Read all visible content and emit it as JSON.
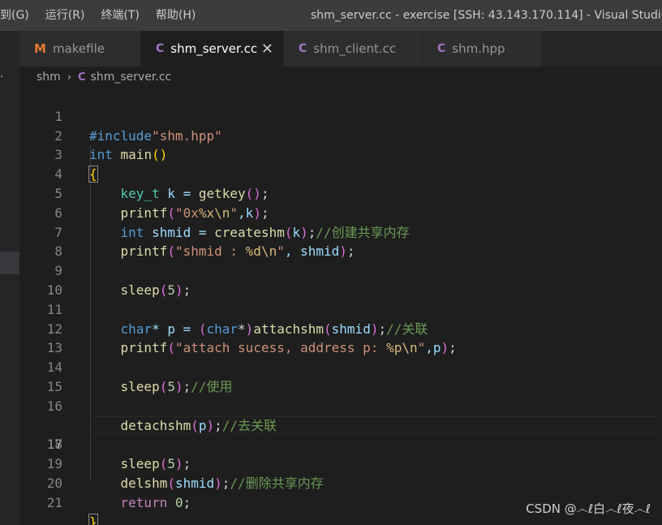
{
  "menu": [
    "到(G)",
    "运行(R)",
    "终端(T)",
    "帮助(H)"
  ],
  "window_title": "shm_server.cc - exercise [SSH: 43.143.170.114] - Visual Studio Code",
  "activity_dots": "·",
  "tabs": [
    {
      "label": "makefile",
      "icon": "M",
      "icon_name": "makefile-icon"
    },
    {
      "label": "shm_server.cc",
      "icon": "C",
      "icon_name": "cpp-file-icon",
      "active": true,
      "close": "✕"
    },
    {
      "label": "shm_client.cc",
      "icon": "C",
      "icon_name": "cpp-file-icon"
    },
    {
      "label": "shm.hpp",
      "icon": "C",
      "icon_name": "cpp-file-icon"
    }
  ],
  "breadcrumb": {
    "folder": "shm",
    "separator": "›",
    "file_icon": "C",
    "file": "shm_server.cc"
  },
  "current_line": 17,
  "line_numbers": [
    "1",
    "2",
    "3",
    "4",
    "5",
    "6",
    "7",
    "8",
    "9",
    "10",
    "11",
    "12",
    "13",
    "14",
    "15",
    "16",
    "17",
    "18",
    "19",
    "20",
    "21"
  ],
  "code": {
    "l1_a": "#include",
    "l1_b": "\"shm.hpp\"",
    "l2_a": "int",
    "l2_b": " main",
    "l2_c": "()",
    "l3": "{",
    "l4_a": "key_t",
    "l4_b": " k = ",
    "l4_c": "getkey",
    "l4_d": "()",
    "l4_e": ";",
    "l5_a": "printf",
    "l5_b": "(",
    "l5_c": "\"0x",
    "l5_d": "%x\\n",
    "l5_e": "\"",
    "l5_f": ",k",
    "l5_g": ")",
    "l5_h": ";",
    "l6_a": "int",
    "l6_b": " shmid = ",
    "l6_c": "createshm",
    "l6_d": "(",
    "l6_e": "k",
    "l6_f": ")",
    "l6_g": ";",
    "l6_h": "//创建共享内存",
    "l7_a": "printf",
    "l7_b": "(",
    "l7_c": "\"shmid : ",
    "l7_d": "%d\\n",
    "l7_e": "\"",
    "l7_f": ", shmid",
    "l7_g": ")",
    "l7_h": ";",
    "l9_a": "sleep",
    "l9_b": "(",
    "l9_c": "5",
    "l9_d": ")",
    "l9_e": ";",
    "l11_a": "char",
    "l11_b": "* p = ",
    "l11_c": "(",
    "l11_d": "char",
    "l11_e": "*",
    "l11_f": ")",
    "l11_g": "attachshm",
    "l11_h": "(",
    "l11_i": "shmid",
    "l11_j": ")",
    "l11_k": ";",
    "l11_l": "//关联",
    "l12_a": "printf",
    "l12_b": "(",
    "l12_c": "\"attach sucess, address p: ",
    "l12_d": "%p\\n",
    "l12_e": "\"",
    "l12_f": ",p",
    "l12_g": ")",
    "l12_h": ";",
    "l14_a": "sleep",
    "l14_b": "(",
    "l14_c": "5",
    "l14_d": ")",
    "l14_e": ";",
    "l14_f": "//使用",
    "l16_a": "detachshm",
    "l16_b": "(",
    "l16_c": "p",
    "l16_d": ")",
    "l16_e": ";",
    "l16_f": "//去关联",
    "l17_a": "sleep",
    "l17_b": "(",
    "l17_c": "5",
    "l17_d": ")",
    "l17_e": ";",
    "l19_a": "delshm",
    "l19_b": "(",
    "l19_c": "shmid",
    "l19_d": ")",
    "l19_e": ";",
    "l19_f": "//删除共享内存",
    "l20_a": "return",
    "l20_b": " 0",
    "l20_c": ";",
    "l21": "}"
  },
  "watermark": "CSDN @෴ℓ白෴ℓ夜෴ℓ",
  "colors": {
    "background": "#1e1e1e",
    "titlebar": "#3c3c3c",
    "keyword": "#569cd6",
    "string": "#ce9178",
    "function": "#dcdcaa",
    "number": "#b5cea8",
    "comment": "#6a9955",
    "type": "#4ec9b0"
  }
}
